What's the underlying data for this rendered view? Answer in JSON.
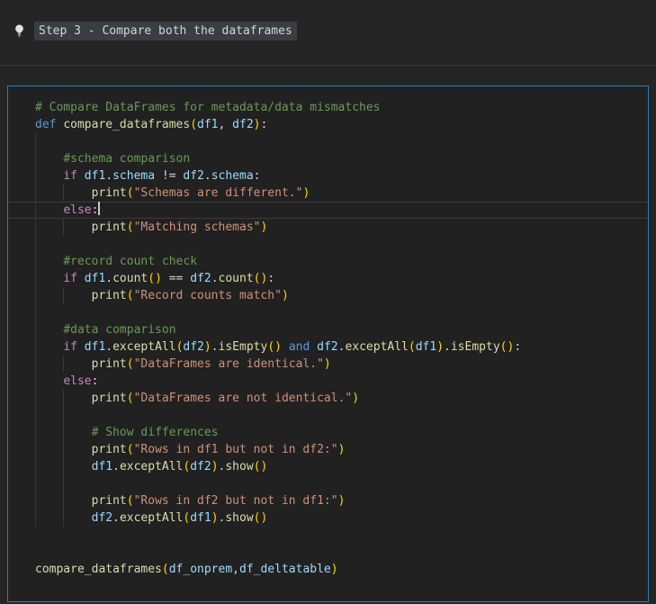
{
  "header": {
    "icon": "lightbulb-icon",
    "title": "Step 3 - Compare both the dataframes"
  },
  "editor": {
    "cursor": {
      "line_index": 6,
      "after_text": "else:"
    },
    "lines": [
      {
        "indent": 0,
        "guides": 0,
        "tokens": [
          [
            "# Compare DataFrames for metadata/data mismatches",
            "cm"
          ]
        ]
      },
      {
        "indent": 0,
        "guides": 0,
        "tokens": [
          [
            "def",
            "kw"
          ],
          [
            " ",
            "pl"
          ],
          [
            "compare_dataframes",
            "fn"
          ],
          [
            "(",
            "br"
          ],
          [
            "df1",
            "vr"
          ],
          [
            ", ",
            "pl"
          ],
          [
            "df2",
            "vr"
          ],
          [
            ")",
            "br"
          ],
          [
            ":",
            "pl"
          ]
        ]
      },
      {
        "indent": 0,
        "guides": 1,
        "tokens": []
      },
      {
        "indent": 4,
        "guides": 1,
        "tokens": [
          [
            "#schema comparison",
            "cm"
          ]
        ]
      },
      {
        "indent": 4,
        "guides": 1,
        "tokens": [
          [
            "if",
            "ct"
          ],
          [
            " ",
            "pl"
          ],
          [
            "df1",
            "vr"
          ],
          [
            ".",
            "pl"
          ],
          [
            "schema",
            "vr"
          ],
          [
            " ",
            "pl"
          ],
          [
            "!=",
            "op"
          ],
          [
            " ",
            "pl"
          ],
          [
            "df2",
            "vr"
          ],
          [
            ".",
            "pl"
          ],
          [
            "schema",
            "vr"
          ],
          [
            ":",
            "pl"
          ]
        ]
      },
      {
        "indent": 8,
        "guides": 2,
        "tokens": [
          [
            "print",
            "fn"
          ],
          [
            "(",
            "br"
          ],
          [
            "\"Schemas are different.\"",
            "st"
          ],
          [
            ")",
            "br"
          ]
        ]
      },
      {
        "indent": 4,
        "guides": 1,
        "current": true,
        "cursor": true,
        "tokens": [
          [
            "else",
            "ct"
          ],
          [
            ":",
            "pl"
          ]
        ]
      },
      {
        "indent": 8,
        "guides": 2,
        "tokens": [
          [
            "print",
            "fn"
          ],
          [
            "(",
            "br"
          ],
          [
            "\"Matching schemas\"",
            "st"
          ],
          [
            ")",
            "br"
          ]
        ]
      },
      {
        "indent": 0,
        "guides": 1,
        "tokens": []
      },
      {
        "indent": 4,
        "guides": 1,
        "tokens": [
          [
            "#record count check",
            "cm"
          ]
        ]
      },
      {
        "indent": 4,
        "guides": 1,
        "tokens": [
          [
            "if",
            "ct"
          ],
          [
            " ",
            "pl"
          ],
          [
            "df1",
            "vr"
          ],
          [
            ".",
            "pl"
          ],
          [
            "count",
            "fn"
          ],
          [
            "()",
            "br"
          ],
          [
            " ",
            "pl"
          ],
          [
            "==",
            "op"
          ],
          [
            " ",
            "pl"
          ],
          [
            "df2",
            "vr"
          ],
          [
            ".",
            "pl"
          ],
          [
            "count",
            "fn"
          ],
          [
            "()",
            "br"
          ],
          [
            ":",
            "pl"
          ]
        ]
      },
      {
        "indent": 8,
        "guides": 2,
        "tokens": [
          [
            "print",
            "fn"
          ],
          [
            "(",
            "br"
          ],
          [
            "\"Record counts match\"",
            "st"
          ],
          [
            ")",
            "br"
          ]
        ]
      },
      {
        "indent": 0,
        "guides": 1,
        "tokens": []
      },
      {
        "indent": 4,
        "guides": 1,
        "tokens": [
          [
            "#data comparison",
            "cm"
          ]
        ]
      },
      {
        "indent": 4,
        "guides": 1,
        "tokens": [
          [
            "if",
            "ct"
          ],
          [
            " ",
            "pl"
          ],
          [
            "df1",
            "vr"
          ],
          [
            ".",
            "pl"
          ],
          [
            "exceptAll",
            "fn"
          ],
          [
            "(",
            "br"
          ],
          [
            "df2",
            "vr"
          ],
          [
            ")",
            "br"
          ],
          [
            ".",
            "pl"
          ],
          [
            "isEmpty",
            "fn"
          ],
          [
            "()",
            "br"
          ],
          [
            " ",
            "pl"
          ],
          [
            "and",
            "kw"
          ],
          [
            " ",
            "pl"
          ],
          [
            "df2",
            "vr"
          ],
          [
            ".",
            "pl"
          ],
          [
            "exceptAll",
            "fn"
          ],
          [
            "(",
            "br"
          ],
          [
            "df1",
            "vr"
          ],
          [
            ")",
            "br"
          ],
          [
            ".",
            "pl"
          ],
          [
            "isEmpty",
            "fn"
          ],
          [
            "()",
            "br"
          ],
          [
            ":",
            "pl"
          ]
        ]
      },
      {
        "indent": 8,
        "guides": 2,
        "tokens": [
          [
            "print",
            "fn"
          ],
          [
            "(",
            "br"
          ],
          [
            "\"DataFrames are identical.\"",
            "st"
          ],
          [
            ")",
            "br"
          ]
        ]
      },
      {
        "indent": 4,
        "guides": 1,
        "tokens": [
          [
            "else",
            "ct"
          ],
          [
            ":",
            "pl"
          ]
        ]
      },
      {
        "indent": 8,
        "guides": 2,
        "tokens": [
          [
            "print",
            "fn"
          ],
          [
            "(",
            "br"
          ],
          [
            "\"DataFrames are not identical.\"",
            "st"
          ],
          [
            ")",
            "br"
          ]
        ]
      },
      {
        "indent": 0,
        "guides": 2,
        "tokens": []
      },
      {
        "indent": 8,
        "guides": 2,
        "tokens": [
          [
            "# Show differences",
            "cm"
          ]
        ]
      },
      {
        "indent": 8,
        "guides": 2,
        "tokens": [
          [
            "print",
            "fn"
          ],
          [
            "(",
            "br"
          ],
          [
            "\"Rows in df1 but not in df2:\"",
            "st"
          ],
          [
            ")",
            "br"
          ]
        ]
      },
      {
        "indent": 8,
        "guides": 2,
        "tokens": [
          [
            "df1",
            "vr"
          ],
          [
            ".",
            "pl"
          ],
          [
            "exceptAll",
            "fn"
          ],
          [
            "(",
            "br"
          ],
          [
            "df2",
            "vr"
          ],
          [
            ")",
            "br"
          ],
          [
            ".",
            "pl"
          ],
          [
            "show",
            "fn"
          ],
          [
            "()",
            "br"
          ]
        ]
      },
      {
        "indent": 0,
        "guides": 2,
        "tokens": []
      },
      {
        "indent": 8,
        "guides": 2,
        "tokens": [
          [
            "print",
            "fn"
          ],
          [
            "(",
            "br"
          ],
          [
            "\"Rows in df2 but not in df1:\"",
            "st"
          ],
          [
            ")",
            "br"
          ]
        ]
      },
      {
        "indent": 8,
        "guides": 2,
        "tokens": [
          [
            "df2",
            "vr"
          ],
          [
            ".",
            "pl"
          ],
          [
            "exceptAll",
            "fn"
          ],
          [
            "(",
            "br"
          ],
          [
            "df1",
            "vr"
          ],
          [
            ")",
            "br"
          ],
          [
            ".",
            "pl"
          ],
          [
            "show",
            "fn"
          ],
          [
            "()",
            "br"
          ]
        ]
      },
      {
        "indent": 0,
        "guides": 0,
        "tokens": []
      },
      {
        "indent": 0,
        "guides": 0,
        "tokens": []
      },
      {
        "indent": 0,
        "guides": 0,
        "tokens": [
          [
            "compare_dataframes",
            "fn"
          ],
          [
            "(",
            "br"
          ],
          [
            "df_onprem",
            "vr"
          ],
          [
            ",",
            "pl"
          ],
          [
            "df_deltatable",
            "vr"
          ],
          [
            ")",
            "br"
          ]
        ]
      }
    ]
  },
  "colors": {
    "page_background": "#252526",
    "cell_background": "#212121",
    "cell_border": "#2f7cb6",
    "title_highlight": "#3a3d41",
    "comment": "#6A9955",
    "keyword": "#569CD6",
    "control_keyword": "#C586C0",
    "function": "#DCDCAA",
    "variable": "#9CDCFE",
    "string": "#CE9178",
    "bracket": "#FFD700",
    "text": "#D4D4D4",
    "indent_guide": "#383838"
  }
}
